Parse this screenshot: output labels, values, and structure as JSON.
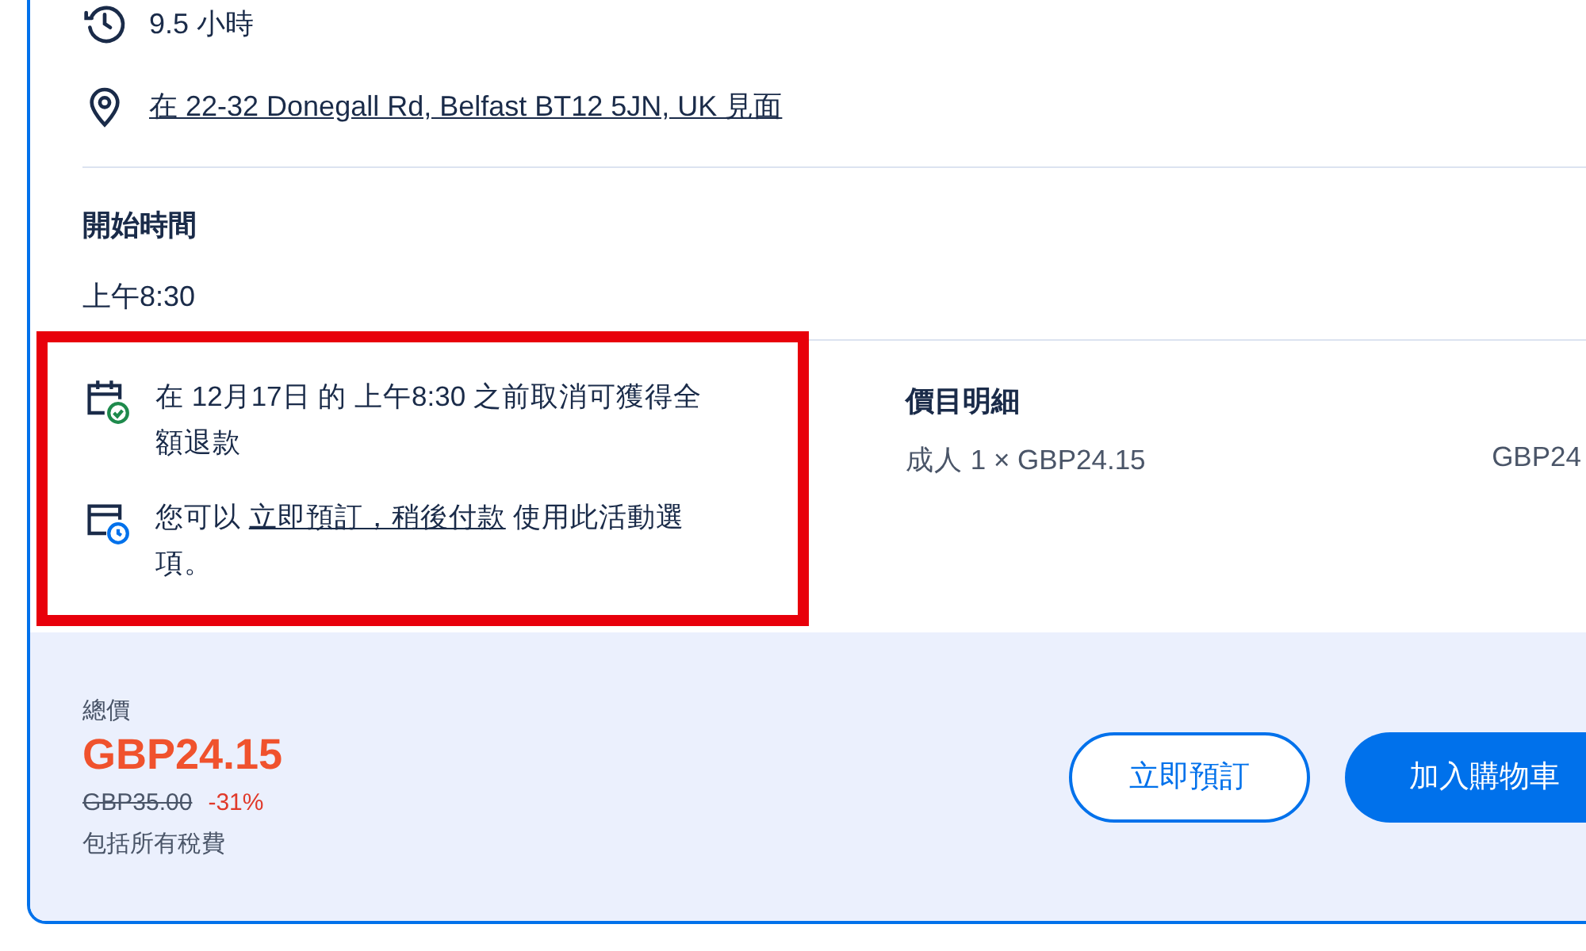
{
  "details": [
    {
      "kind": "duration",
      "text": "9.5 小時",
      "link": false
    },
    {
      "kind": "location",
      "text": "在 22-32 Donegall Rd, Belfast BT12 5JN, UK 見面",
      "link": true
    }
  ],
  "start_time": {
    "label": "開始時間",
    "value": "上午8:30"
  },
  "policies": {
    "highlighted": true,
    "items": [
      {
        "kind": "cancellation",
        "before": "在 12月17日 的 上午8:30 之前取消可獲得全額退款"
      },
      {
        "kind": "reserve",
        "before": "您可以 ",
        "link": "立即預訂，稍後付款",
        "after": " 使用此活動選項。"
      }
    ]
  },
  "price_breakdown": {
    "title": "價目明細",
    "rows": [
      {
        "label": "成人 1 × GBP24.15",
        "amount": "GBP24"
      }
    ]
  },
  "total": {
    "label": "總價",
    "price": "GBP24.15",
    "original_price": "GBP35.00",
    "discount": "-31%",
    "note": "包括所有稅費"
  },
  "buttons": [
    {
      "label": "立即預訂",
      "kind": "outline"
    },
    {
      "label": "加入購物車",
      "kind": "primary"
    }
  ]
}
